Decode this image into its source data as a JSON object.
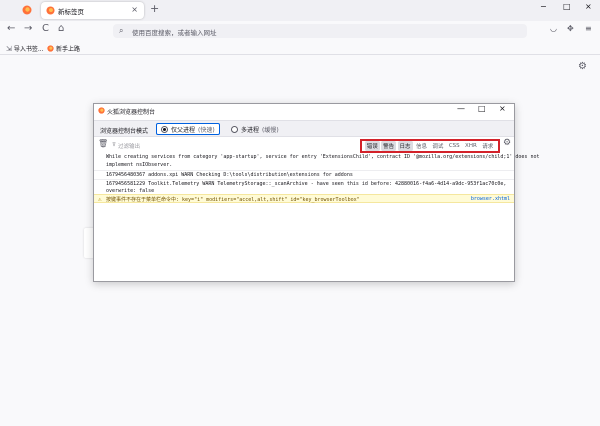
{
  "browser": {
    "tab_title": "新标签页",
    "tab_close": "×",
    "new_tab": "+",
    "minimize": "−",
    "maximize": "□",
    "close": "×",
    "back": "←",
    "forward": "→",
    "reload": "C",
    "home": "⌂",
    "url_placeholder": "使用百度搜索，或者输入网址",
    "bookmarks": [
      {
        "label": "导入书签...",
        "icon": "import-icon"
      },
      {
        "label": "新手上路",
        "icon": "firefox-icon"
      }
    ]
  },
  "console": {
    "title": "火狐浏览器控制台",
    "minimize": "—",
    "maximize": "□",
    "close": "×",
    "mode_label": "浏览器控制台模式",
    "modes": [
      {
        "label": "仅父进程",
        "hint": "(快速)",
        "selected": true
      },
      {
        "label": "多进程",
        "hint": "(缓慢)",
        "selected": false
      }
    ],
    "filter_placeholder": "过滤输出",
    "levels": [
      {
        "label": "错误",
        "on": true
      },
      {
        "label": "警告",
        "on": true
      },
      {
        "label": "日志",
        "on": true
      },
      {
        "label": "信息",
        "on": false
      },
      {
        "label": "调试",
        "on": false
      },
      {
        "label": "CSS",
        "on": false
      },
      {
        "label": "XHR",
        "on": false
      },
      {
        "label": "请求",
        "on": false
      }
    ],
    "messages": [
      "While creating services from category 'app-startup', service for entry 'ExtensionsChild', contract ID '@mozilla.org/extensions/child;1' does not",
      "implement nsIObserver.",
      "1679456480367     addons.xpi      WARN    Checking D:\\tools\\distribution\\extensions for addons",
      "1679456581229     Toolkit.Telemetry       WARN    TelemetryStorage::_scanArchive - have seen this id before: 42880016-f4a6-4d14-a9dc-953f1ac70c0e,",
      "overwrite: false"
    ],
    "warning": {
      "text": "按键事件不存在于菜单栏命令中: key=\"i\" modifiers=\"accel,alt,shift\" id=\"key_browserToolbox\"",
      "source": "browser.xhtml"
    }
  }
}
